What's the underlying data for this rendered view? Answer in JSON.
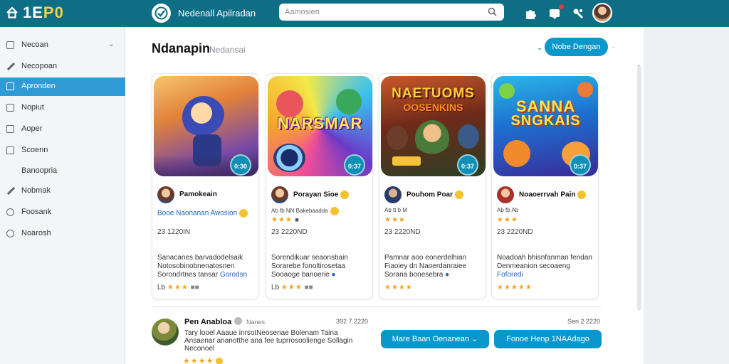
{
  "app": {
    "logo_text": "1E",
    "logo_accent": "P0",
    "brand_name": "Nedenall Apilradan",
    "search_placeholder": "Aamosien"
  },
  "sidebar": {
    "items": [
      {
        "label": "Necoan",
        "icon": "square-icon"
      },
      {
        "label": "Necopoan",
        "icon": "pen-icon"
      },
      {
        "label": "Apronden",
        "icon": "square-icon",
        "active": true
      },
      {
        "label": "Nopiut",
        "icon": "square-icon"
      },
      {
        "label": "Aoper",
        "icon": "square-icon"
      },
      {
        "label": "Scoenn",
        "icon": "square-icon"
      },
      {
        "label": "Banoopria",
        "icon": "none"
      },
      {
        "label": "Nobmak",
        "icon": "pen-icon"
      },
      {
        "label": "Foosank",
        "icon": "circle-icon"
      },
      {
        "label": "Noarosh",
        "icon": "circle-icon"
      }
    ]
  },
  "main": {
    "title": "Ndanapin",
    "subtitle": "Nedansai",
    "primary_button": "Nobe Dengan"
  },
  "cards": [
    {
      "art_title": "",
      "art_subtitle": "",
      "badge": "0:30",
      "author": "Pamokeain",
      "link": "Booe Naonanan Awosion",
      "count": "23 1220IN",
      "desc1": "Sanacanes barvadodelsaik",
      "desc2": "Notosobinobnenatosnen",
      "desc3_plain": "Sorondrtnes tansar ",
      "desc3_link": "Gorodsn",
      "foot": "Lb"
    },
    {
      "art_title": "NARSMAR",
      "art_subtitle": "",
      "badge": "0:37",
      "author": "Porayan Sioe",
      "meta": "Ab  fb  NN  Bakebaadda",
      "count": "23 2220ND",
      "desc1": "Sorendikuar seaonsbain",
      "desc2": "Sorarebe fonoltirosetaa",
      "desc3_plain": "Sooaoge banoerie ",
      "desc3_link": "",
      "foot": "Lb"
    },
    {
      "art_title": "NAETUOMS",
      "art_subtitle": "OOSENKINS",
      "badge": "0:37",
      "author": "Pouhom Poar",
      "meta": "Ab  tt  b  M",
      "count": "23 2220ND",
      "desc1": "Pamnar aoo eonerdelhian",
      "desc2": "Fiaoiey dn Naoerdanraiee",
      "desc3_plain": "Sorana bonesebra ",
      "desc3_link": "",
      "foot": ""
    },
    {
      "art_title": "SANNA",
      "art_subtitle": "SNGKAIS",
      "badge": "0:37",
      "author": "Noaoerrvah Pain",
      "meta": "Ab  fb  Ab",
      "count": "23 2220ND",
      "desc1": "Noadoah bhisnfanman fendan",
      "desc2": "Denmeanion secoaeng ",
      "desc2_link": "Foforedi",
      "desc3_plain": "",
      "desc3_link": "",
      "foot": ""
    }
  ],
  "review": {
    "author": "Pen Anabloa",
    "tag": "Nanes",
    "time": "392 7 2220",
    "time2": "Sen 2 2220",
    "line1": "Tary looel Aaaue inrsotNeosenae Bolenam Taina",
    "line2": "Ansaenar ananotthe ana fee tuprrosoolienge Sollagin",
    "line3": "Neconoel",
    "button1": "Mare Baan Oenanean",
    "button2": "Fonoe Henp 1NAAdago"
  },
  "colors": {
    "topbar": "#0d6e86",
    "accent": "#0c97cc",
    "sidebar_active": "#2e9ad6",
    "star": "#f1a51b"
  }
}
